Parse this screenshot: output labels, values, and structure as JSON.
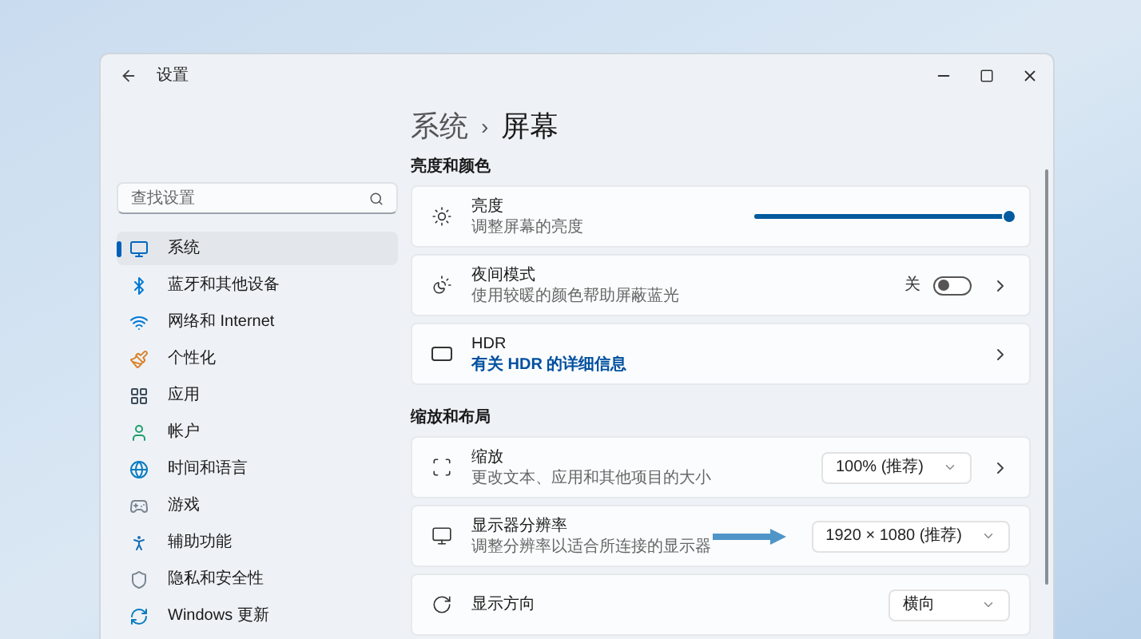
{
  "window": {
    "title": "设置"
  },
  "search": {
    "placeholder": "查找设置"
  },
  "sidebar": {
    "items": [
      {
        "label": "系统",
        "selected": true
      },
      {
        "label": "蓝牙和其他设备",
        "selected": false
      },
      {
        "label": "网络和 Internet",
        "selected": false
      },
      {
        "label": "个性化",
        "selected": false
      },
      {
        "label": "应用",
        "selected": false
      },
      {
        "label": "帐户",
        "selected": false
      },
      {
        "label": "时间和语言",
        "selected": false
      },
      {
        "label": "游戏",
        "selected": false
      },
      {
        "label": "辅助功能",
        "selected": false
      },
      {
        "label": "隐私和安全性",
        "selected": false
      },
      {
        "label": "Windows 更新",
        "selected": false
      }
    ]
  },
  "breadcrumb": {
    "parent": "系统",
    "separator": "›",
    "current": "屏幕"
  },
  "sections": [
    {
      "heading": "亮度和颜色",
      "cards": [
        {
          "kind": "slider",
          "title": "亮度",
          "subtitle": "调整屏幕的亮度",
          "level": 1.0
        },
        {
          "kind": "toggle",
          "title": "夜间模式",
          "subtitle": "使用较暖的颜色帮助屏蔽蓝光",
          "state_label": "关",
          "on": false
        },
        {
          "kind": "link",
          "title": "HDR",
          "link": "有关 HDR 的详细信息"
        }
      ]
    },
    {
      "heading": "缩放和布局",
      "cards": [
        {
          "kind": "dropdown",
          "title": "缩放",
          "subtitle": "更改文本、应用和其他项目的大小",
          "value": "100% (推荐)",
          "chevron": true,
          "annotated": false
        },
        {
          "kind": "dropdown",
          "title": "显示器分辨率",
          "subtitle": "调整分辨率以适合所连接的显示器",
          "value": "1920 × 1080 (推荐)",
          "chevron": false,
          "annotated": true
        },
        {
          "kind": "dropdown",
          "title": "显示方向",
          "value": "横向",
          "chevron": false,
          "annotated": false
        }
      ]
    }
  ]
}
